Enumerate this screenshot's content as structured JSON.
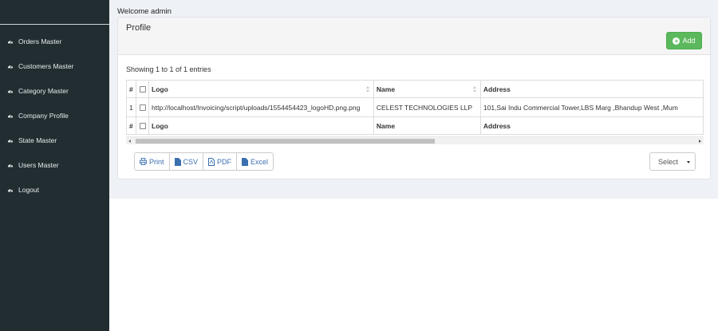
{
  "sidebar": {
    "items": [
      {
        "label": "Orders Master",
        "icon": "dashboard-icon"
      },
      {
        "label": "Customers Master",
        "icon": "dashboard-icon"
      },
      {
        "label": "Category Master",
        "icon": "dashboard-icon"
      },
      {
        "label": "Company Profile",
        "icon": "dashboard-icon"
      },
      {
        "label": "State Master",
        "icon": "dashboard-icon"
      },
      {
        "label": "Users Master",
        "icon": "dashboard-icon"
      },
      {
        "label": "Logout",
        "icon": "dashboard-icon"
      }
    ]
  },
  "header": {
    "welcome": "Welcome admin"
  },
  "panel": {
    "title": "Profile",
    "add_label": "Add",
    "showing": "Showing 1 to 1 of 1 entries"
  },
  "table": {
    "columns": [
      "#",
      "",
      "Logo",
      "Name",
      "Address"
    ],
    "rows": [
      {
        "num": "1",
        "logo": "http://localhost/Invoicing/script/uploads/1554454423_logoHD.png.png",
        "name": "CELEST TECHNOLOGIES LLP",
        "address": "101,Sai Indu Commercial Tower,LBS Marg ,Bhandup West ,Mum"
      }
    ],
    "footer_columns": [
      "#",
      "",
      "Logo",
      "Name",
      "Address"
    ]
  },
  "exports": {
    "print": "Print",
    "csv": "CSV",
    "pdf": "PDF",
    "excel": "Excel"
  },
  "select": {
    "value": "Select"
  },
  "colors": {
    "sidebar": "#222d32",
    "accent": "#5cb85c",
    "link": "#3a6fb0"
  }
}
